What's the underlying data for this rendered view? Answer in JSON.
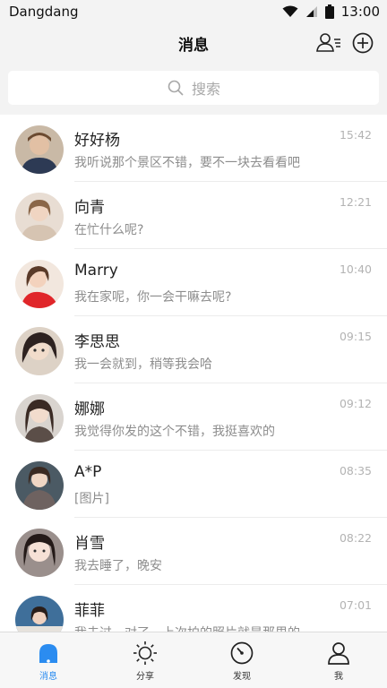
{
  "status_bar": {
    "carrier": "Dangdang",
    "time": "13:00"
  },
  "nav": {
    "title": "消息"
  },
  "search": {
    "placeholder": "搜索"
  },
  "conversations": [
    {
      "name": "好好杨",
      "message": "我听说那个景区不错，要不一块去看看吧",
      "time": "15:42"
    },
    {
      "name": "向青",
      "message": "在忙什么呢?",
      "time": "12:21"
    },
    {
      "name": "Marry",
      "message": "我在家呢，你一会干嘛去呢?",
      "time": "10:40"
    },
    {
      "name": "李思思",
      "message": "我一会就到，稍等我会哈",
      "time": "09:15"
    },
    {
      "name": "娜娜",
      "message": "我觉得你发的这个不错，我挺喜欢的",
      "time": "09:12"
    },
    {
      "name": "A*P",
      "message": "[图片]",
      "time": "08:35"
    },
    {
      "name": "肖雪",
      "message": "我去睡了，晚安",
      "time": "08:22"
    },
    {
      "name": "菲菲",
      "message": "我去过，对了，上次拍的照片就是那里的",
      "time": "07:01"
    }
  ],
  "tabs": [
    {
      "label": "消息",
      "icon": "bell-icon",
      "active": true
    },
    {
      "label": "分享",
      "icon": "sun-icon",
      "active": false
    },
    {
      "label": "发现",
      "icon": "compass-icon",
      "active": false
    },
    {
      "label": "我",
      "icon": "person-icon",
      "active": false
    }
  ],
  "colors": {
    "accent": "#2b8cf0",
    "background": "#f3f3f3"
  }
}
